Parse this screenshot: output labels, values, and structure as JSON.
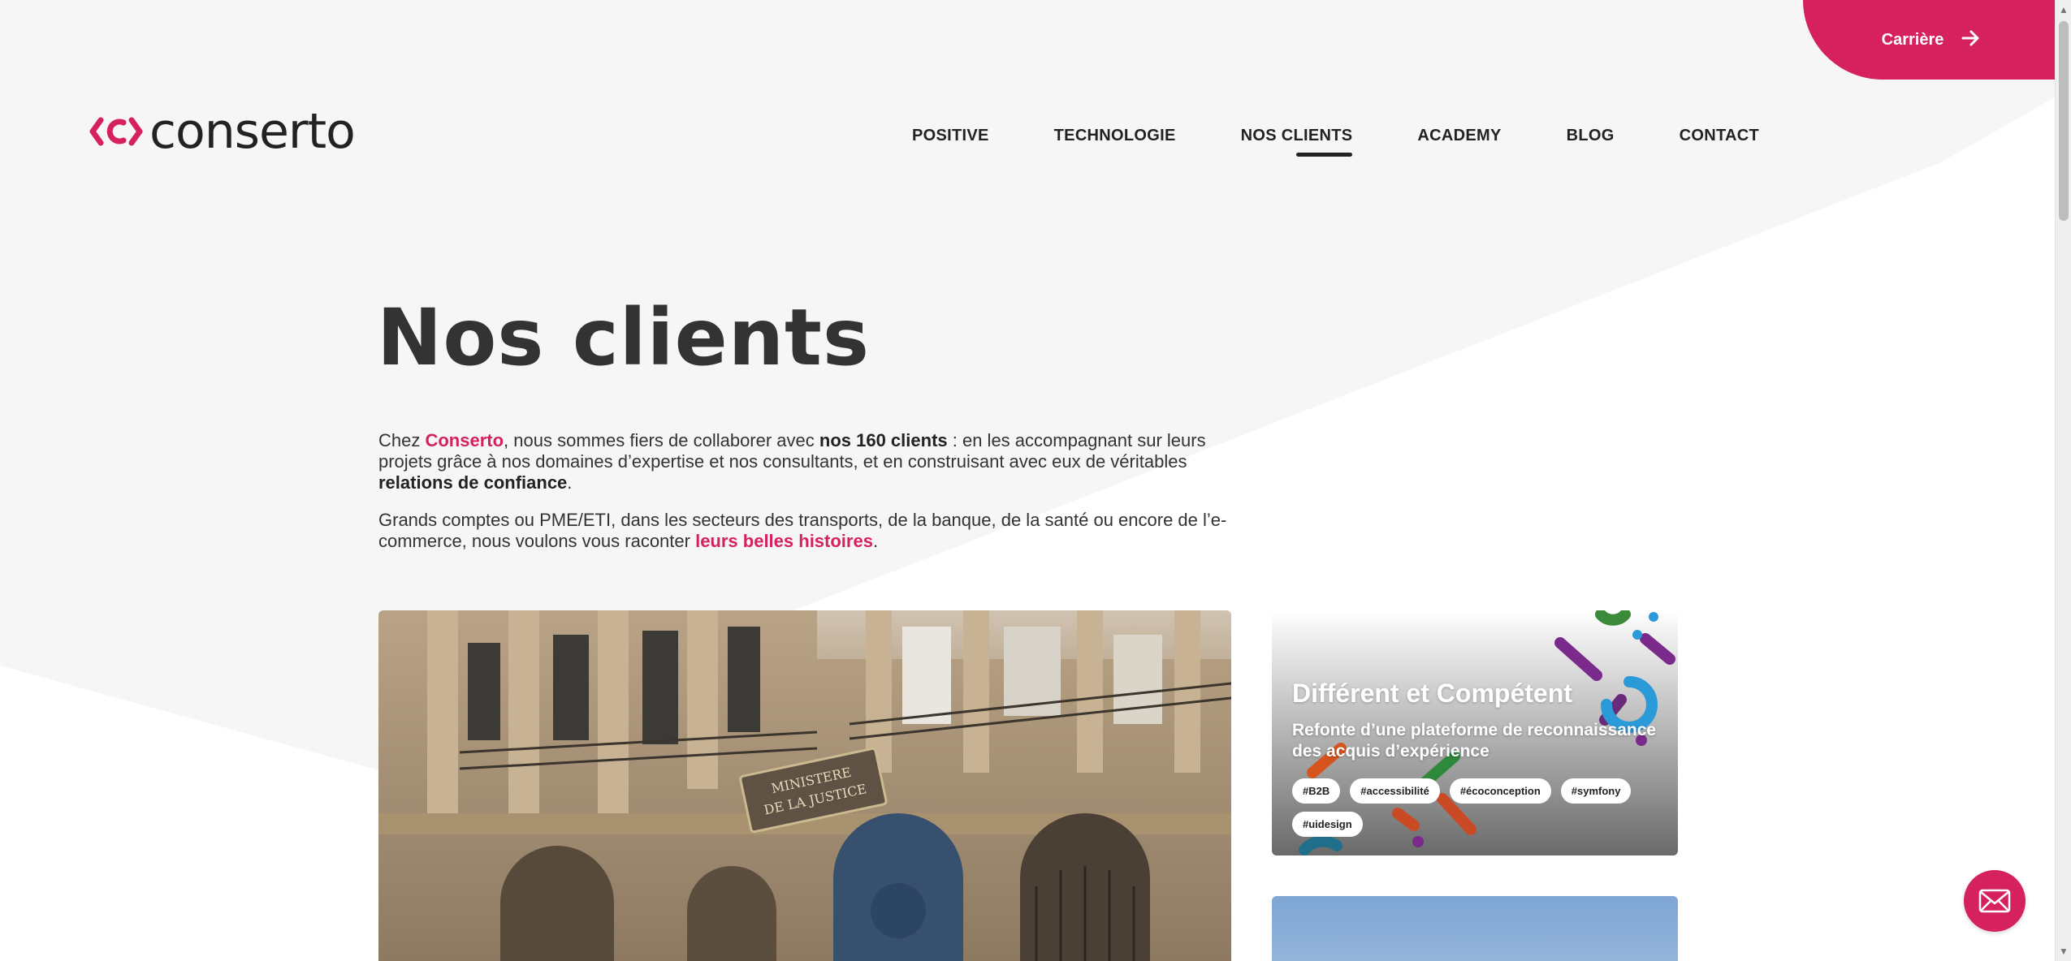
{
  "header": {
    "career_label": "Carrière",
    "logo_text": "conserto",
    "nav": [
      {
        "label": "POSITIVE"
      },
      {
        "label": "TECHNOLOGIE"
      },
      {
        "label": "NOS CLIENTS",
        "active": true
      },
      {
        "label": "ACADEMY"
      },
      {
        "label": "BLOG"
      },
      {
        "label": "CONTACT"
      }
    ]
  },
  "main": {
    "title": "Nos clients",
    "intro": {
      "p1_a": "Chez ",
      "p1_brand": "Conserto",
      "p1_b": ", nous sommes fiers de collaborer avec ",
      "p1_bold": "nos 160 clients",
      "p1_c": " : en les accompagnant sur leurs projets grâce à nos domaines d’expertise et nos consultants, et en construisant avec eux de véritables ",
      "p1_bold2": "relations de confiance",
      "p1_d": ".",
      "p2_a": "Grands comptes ou PME/ETI, dans les secteurs des transports, de la banque, de la santé ou encore de l’e-commerce, nous voulons vous raconter ",
      "p2_link": "leurs belles histoires",
      "p2_b": "."
    },
    "photo": {
      "sign_line1": "MINISTERE",
      "sign_line2": "DE LA JUSTICE"
    },
    "card": {
      "title": "Différent et Compétent",
      "subtitle": "Refonte d’une plateforme de reconnaissance des acquis d’expérience",
      "tags": [
        "#B2B",
        "#accessibilité",
        "#écoconception",
        "#symfony",
        "#uidesign"
      ]
    }
  },
  "colors": {
    "accent": "#d6215f",
    "background": "#f6f6f6",
    "text": "#333333"
  },
  "icons": {
    "career_arrow": "arrow-right-icon",
    "contact": "envelope-icon"
  }
}
